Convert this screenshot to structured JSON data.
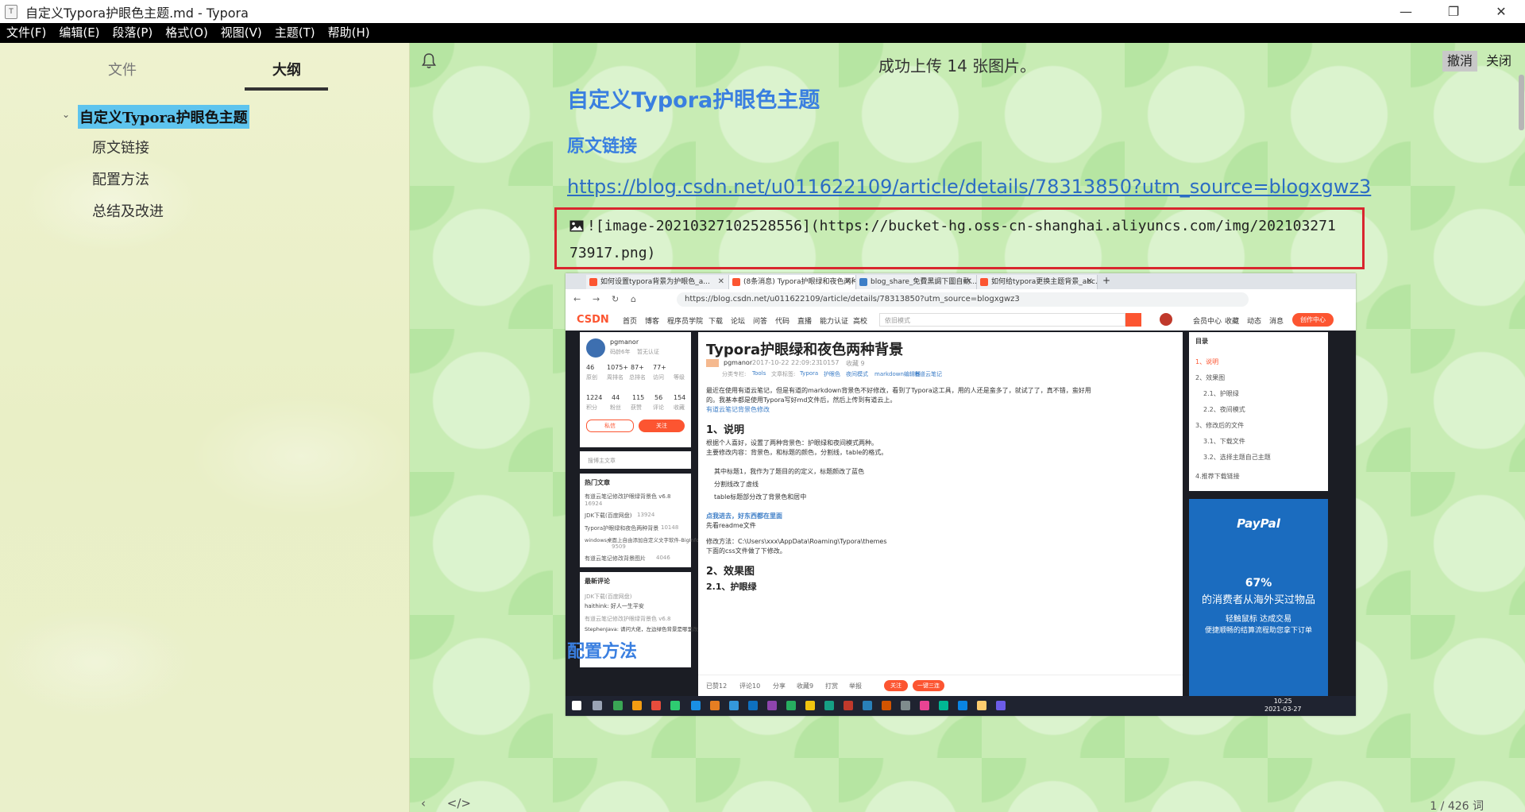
{
  "window": {
    "title": "自定义Typora护眼色主题.md - Typora",
    "app_icon": "T",
    "controls": [
      "—",
      "❐",
      "✕"
    ]
  },
  "menu": [
    "文件(F)",
    "编辑(E)",
    "段落(P)",
    "格式(O)",
    "视图(V)",
    "主题(T)",
    "帮助(H)"
  ],
  "sidebar": {
    "tab_files": "文件",
    "tab_outline": "大纲",
    "outline": [
      "自定义Typora护眼色主题",
      "原文链接",
      "配置方法",
      "总结及改进"
    ]
  },
  "notification": {
    "message": "成功上传 14 张图片。",
    "undo": "撤消",
    "close": "关闭"
  },
  "document": {
    "h1": "自定义Typora护眼色主题",
    "h2_link": "原文链接",
    "url": "https://blog.csdn.net/u011622109/article/details/78313850?utm_source=blogxgwz3",
    "code_line1": "![image-20210327102528556](https://bucket-hg.oss-cn-shanghai.aliyuncs.com/img/202103271",
    "code_line2": "73917.png)",
    "h2_config": "配置方法"
  },
  "footer": {
    "left_icons": [
      "‹",
      "</>"
    ],
    "word_count": "1 / 426 词"
  },
  "screenshot": {
    "tabs": [
      {
        "label": "如何设置typora背景为护眼色_a...",
        "color": "#fc5531"
      },
      {
        "label": "(8条消息) Typora护眼绿和夜色两种...",
        "color": "#fc5531"
      },
      {
        "label": "blog_share_免費黑調下圖自動...",
        "color": "#3d7ec7"
      },
      {
        "label": "如何给typora更换主题背景_abc...",
        "color": "#fc5531"
      }
    ],
    "url": "https://blog.csdn.net/u011622109/article/details/78313850?utm_source=blogxgwz3",
    "csdn_logo": "CSDN",
    "nav_links": [
      "首页",
      "博客",
      "程序员学院",
      "下载",
      "论坛",
      "问答",
      "代码",
      "直播",
      "能力认证",
      "高校"
    ],
    "search_placeholder": "依旧模式",
    "right_links": [
      "会员中心",
      "收藏",
      "动态",
      "消息"
    ],
    "create_btn": "创作中心",
    "profile": {
      "name": "pgmanor",
      "since": "码龄6年",
      "badge": "暂无认证",
      "stats1": [
        [
          "46",
          "原创"
        ],
        [
          "1075+",
          "周排名"
        ],
        [
          "87+",
          "总排名"
        ],
        [
          "77+",
          "访问"
        ],
        [
          "",
          "等级"
        ]
      ],
      "stats2": [
        [
          "1224",
          "积分"
        ],
        [
          "44",
          "粉丝"
        ],
        [
          "115",
          "获赞"
        ],
        [
          "56",
          "评论"
        ],
        [
          "154",
          "收藏"
        ]
      ],
      "btn_chat": "私信",
      "btn_follow": "关注",
      "search": "搜博主文章"
    },
    "hot": {
      "title": "热门文章",
      "items": [
        [
          "有道云笔记修改护眼绿背景色 v6.8",
          "16924"
        ],
        [
          "JDK下载(百度网盘)",
          "13924"
        ],
        [
          "Typora护眼绿和夜色两种背景",
          "10148"
        ],
        [
          "windows桌面上自由添加自定义文字软件-BigInfo",
          "9509"
        ],
        [
          "有道云笔记修改背景图片",
          "4046"
        ]
      ]
    },
    "comments": {
      "title": "最新评论",
      "items": [
        "JDK下载(百度网盘)",
        "haithink: 好人一生平安",
        "有道云笔记修改护眼绿背景色 v6.8",
        "StephenJava: 请问大佬，左边绿色背景是哪里改颜色的?"
      ]
    },
    "article": {
      "title": "Typora护眼绿和夜色两种背景",
      "author": "pgmanor",
      "date": "2017-10-22 22:09:23",
      "views": "10157",
      "fav": "收藏 9",
      "tags_label": "分类专栏:",
      "tags": [
        "Tools",
        "文章标签:",
        "Typora",
        "护眼色",
        "夜间模式",
        "markdown编辑器",
        "有道云笔记"
      ],
      "intro1": "最近在使用有道云笔记，但是有道的markdown背景色不好修改，看到了Typora这工具，用的人还是蛮多了，就试了了，真不错，蛮好用",
      "intro2": "的。我基本都是使用Typora写好md文件后，然后上传到有道云上。",
      "intro_link": "有道云笔记背景色修改",
      "s1": "1、说明",
      "s1p1": "根据个人喜好，设置了两种背景色：护眼绿和夜间模式两种。",
      "s1p2": "主要修改内容：背景色，和标题的颜色，分割线，table的格式。",
      "bullets": [
        "其中标题1，我作为了题目的的定义，标题颜改了蓝色",
        "分割线改了虚线",
        "table标题部分改了背景色和居中"
      ],
      "hint_link": "点我进去，好东西都在里面",
      "hint2": "先看readme文件",
      "path1": "修改方法：C:\\Users\\xxx\\AppData\\Roaming\\Typora\\themes",
      "path2": "下面的css文件做了下修改。",
      "s2": "2、效果图",
      "s21": "2.1、护眼绿",
      "bottom": [
        "已赞12",
        "评论10",
        "分享",
        "收藏9",
        "打赏",
        "举报"
      ],
      "follow": "关注",
      "oneclick": "一键三连"
    },
    "toc": {
      "title": "目录",
      "items": [
        "1、说明",
        "2、效果图",
        "2.1、护眼绿",
        "2.2、夜间模式",
        "3、修改后的文件",
        "3.1、下载文件",
        "3.2、选择主题自己主题",
        "4.推荐下载链接"
      ]
    },
    "ad": {
      "brand": "PayPal",
      "pct": "67%",
      "line1": "的消费者从海外买过物品",
      "line2": "轻触鼠标 达成交易",
      "line3": "便捷顺畅的结算流程助您拿下订单"
    },
    "taskbar_time": "10:25",
    "taskbar_date": "2021-03-27"
  },
  "colors": {
    "heading": "#3a7fe0",
    "link": "#2b6cc4",
    "outline_active": "#5ec4ee",
    "code_border": "#d9262e",
    "csdn_red": "#fc5531"
  }
}
